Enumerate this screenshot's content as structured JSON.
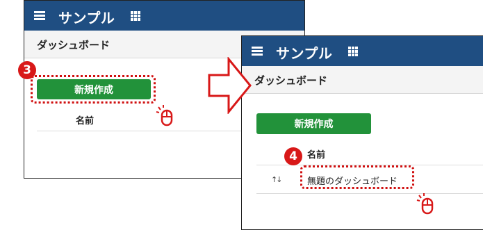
{
  "app": {
    "title": "サンプル"
  },
  "page": {
    "title": "ダッシュボード"
  },
  "toolbar": {
    "create_label": "新規作成"
  },
  "table": {
    "column_name": "名前",
    "rows": [
      {
        "name": "無題のダッシュボード"
      }
    ]
  },
  "steps": {
    "step3": "3",
    "step4": "4"
  },
  "colors": {
    "header": "#1f4e82",
    "create_button": "#22923a",
    "highlight": "#d01010",
    "badge": "#d81818"
  },
  "icons": [
    "hamburger-menu-icon",
    "app-grid-icon",
    "sort-icon",
    "mouse-click-icon",
    "right-arrow-icon"
  ]
}
